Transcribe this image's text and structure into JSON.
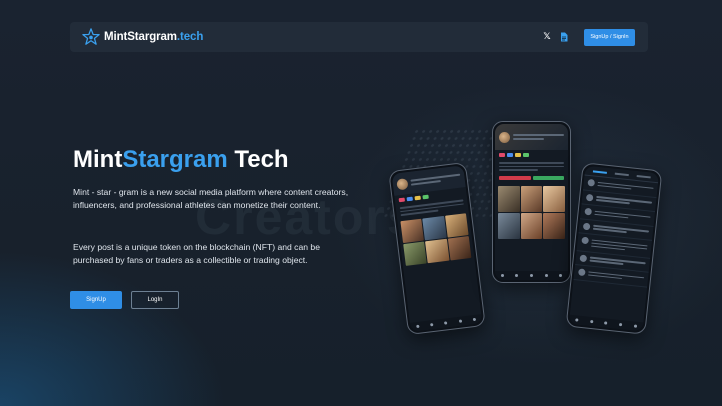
{
  "navbar": {
    "brand_main": "MintStargram",
    "brand_accent": ".tech",
    "logo_icon": "star-logo-icon",
    "social_icons": [
      "x-icon",
      "document-icon"
    ],
    "signup_signin_label": "SignUp / SignIn"
  },
  "hero": {
    "title_part1": "Mint",
    "title_part2": "Stargram",
    "title_part3": " Tech",
    "paragraph1": "Mint - star - gram is a new social media platform where content creators, influencers, and professional athletes can monetize their content.",
    "paragraph2": "Every post is a unique token on the blockchain (NFT) and can be purchased by fans or traders as a collectible or trading object.",
    "signup_label": "SignUp",
    "login_label": "LogIn"
  },
  "colors": {
    "accent": "#3aa0ee",
    "button": "#2f8ee6",
    "background": "#18212c",
    "navbar": "#222c39"
  }
}
